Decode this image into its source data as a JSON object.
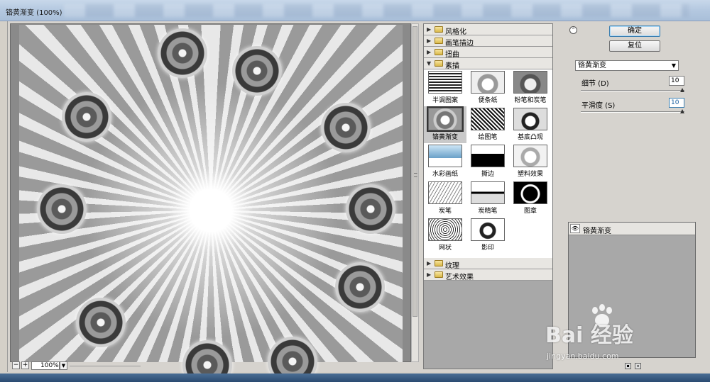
{
  "window": {
    "title": "铬黄渐变 (100%)"
  },
  "zoom": {
    "value": "100%",
    "minus": "−",
    "plus": "+"
  },
  "gallery": {
    "groups_top": [
      {
        "label": "风格化",
        "expanded": false
      },
      {
        "label": "画笔描边",
        "expanded": false
      },
      {
        "label": "扭曲",
        "expanded": false
      },
      {
        "label": "素描",
        "expanded": true
      }
    ],
    "sketch_filters": [
      "半调图案",
      "便条纸",
      "粉笔和炭笔",
      "铬黄渐变",
      "绘图笔",
      "基底凸现",
      "水彩画纸",
      "撕边",
      "塑料效果",
      "炭笔",
      "炭精笔",
      "图章",
      "网状",
      "影印"
    ],
    "selected_filter": "铬黄渐变",
    "groups_bottom": [
      {
        "label": "纹理",
        "expanded": false
      },
      {
        "label": "艺术效果",
        "expanded": false
      }
    ]
  },
  "panel": {
    "ok_label": "确定",
    "reset_label": "复位",
    "filter_select": "铬黄渐变",
    "detail_label": "细节 (D)",
    "detail_value": "10",
    "detail_level": 1.0,
    "smooth_label": "平滑度 (S)",
    "smooth_value": "10",
    "smooth_level": 1.0
  },
  "layers": {
    "items": [
      {
        "name": "铬黄渐变",
        "visible": true
      }
    ]
  },
  "watermark": {
    "text": "Bai 经验",
    "url": "jingyan.baidu.com"
  },
  "colors": {
    "titlebar": "#b4c8e0",
    "dialog_bg": "#d6d3ce",
    "primary_border": "#3c7fb1"
  }
}
